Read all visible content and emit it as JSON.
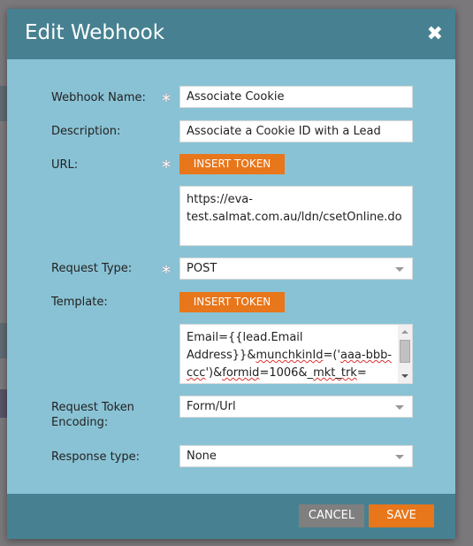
{
  "dialog": {
    "title": "Edit Webhook",
    "close_icon": "close-icon"
  },
  "form": {
    "webhook_name": {
      "label": "Webhook Name:",
      "value": "Associate Cookie",
      "required": true
    },
    "description": {
      "label": "Description:",
      "value": "Associate a Cookie ID with a Lead"
    },
    "url": {
      "label": "URL:",
      "insert_token": "INSERT TOKEN",
      "value": "https://eva-test.salmat.com.au/ldn/csetOnline.do",
      "required": true
    },
    "request_type": {
      "label": "Request Type:",
      "value": "POST",
      "required": true
    },
    "template": {
      "label": "Template:",
      "insert_token": "INSERT TOKEN",
      "line1": "Email={{lead.Email",
      "line2a": "Address}}&",
      "line2b": "munchkinId",
      "line2c": "=('",
      "line2d": "aaa-bbb-",
      "line3a": "ccc",
      "line3b": "')&",
      "line3c": "formid",
      "line3d": "=1006&_",
      "line3e": "mkt_trk",
      "line3f": "="
    },
    "request_token_encoding": {
      "label": "Request Token Encoding:",
      "value": "Form/Url"
    },
    "response_type": {
      "label": "Response type:",
      "value": "None"
    }
  },
  "footer": {
    "cancel": "CANCEL",
    "save": "SAVE"
  },
  "colors": {
    "header": "#478191",
    "body": "#89c2d4",
    "accent": "#e8761a",
    "cancel": "#7f7f7f"
  }
}
